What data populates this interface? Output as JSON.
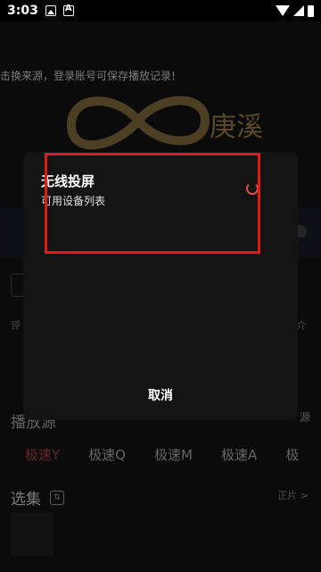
{
  "status_bar": {
    "time": "3:03"
  },
  "background": {
    "notice": "击换来源，登录账号可保存播放记录!",
    "logo_text": "庚溪",
    "small_left": "评",
    "small_right": "介",
    "sources_title": "播放源",
    "sources_right": "源",
    "sources": [
      {
        "label": "极速Y",
        "active": true
      },
      {
        "label": "极速Q",
        "active": false
      },
      {
        "label": "极速M",
        "active": false
      },
      {
        "label": "极速A",
        "active": false
      },
      {
        "label": "极",
        "active": false
      }
    ],
    "episodes_title": "选集",
    "episodes_right": "正片 >"
  },
  "dialog": {
    "title": "无线投屏",
    "subtitle": "可用设备列表",
    "cancel_label": "取消"
  },
  "colors": {
    "highlight": "#e01919",
    "accent": "#a33a3a"
  }
}
